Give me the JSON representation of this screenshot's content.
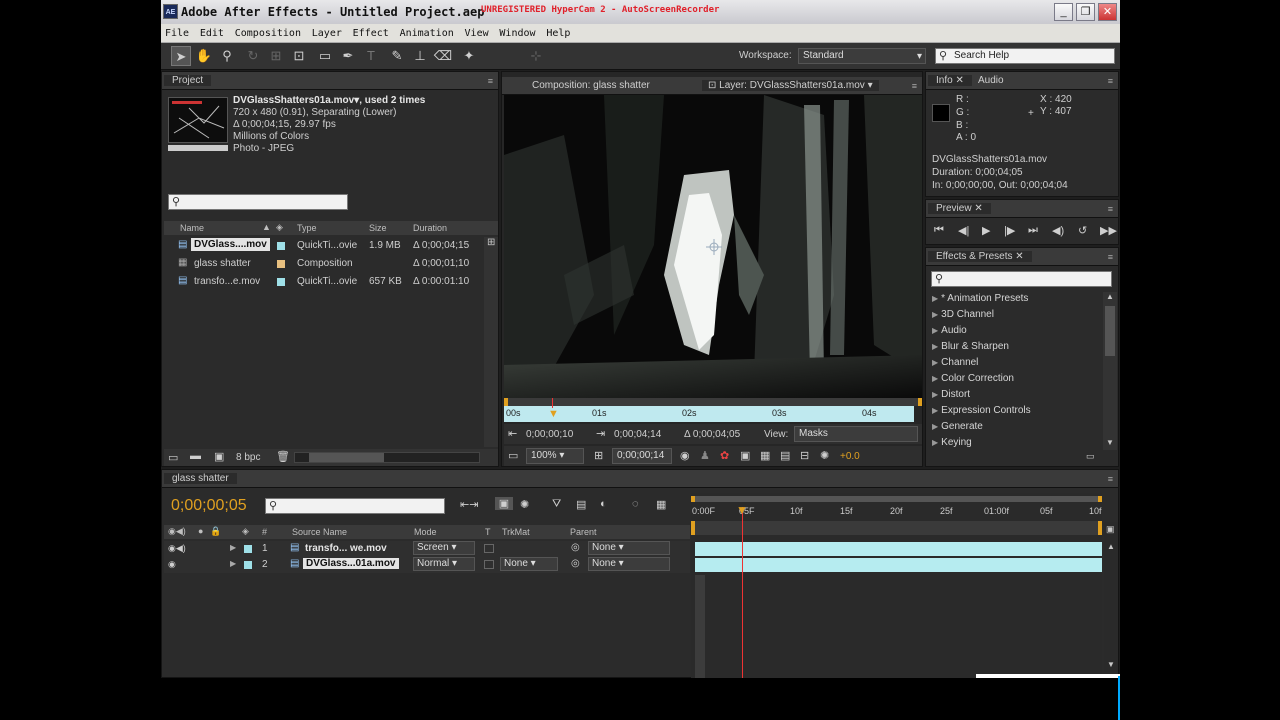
{
  "title_bar": {
    "logo": "AE",
    "title": "Adobe After Effects - Untitled Project.aep",
    "overlay": "UNREGISTERED HyperCam 2 - AutoScreenRecorder"
  },
  "menu": [
    "File",
    "Edit",
    "Composition",
    "Layer",
    "Effect",
    "Animation",
    "View",
    "Window",
    "Help"
  ],
  "toolbar": {
    "workspace_label": "Workspace:",
    "workspace_value": "Standard",
    "search_placeholder": "Search Help"
  },
  "project": {
    "tab": "Project",
    "info_name": "DVGlassShatters01a.mov▾, used 2 times",
    "info_size": "720 x 480 (0.91), Separating (Lower)",
    "info_duration": "Δ 0;00;04;15, 29.97 fps",
    "info_colors": "Millions of Colors",
    "info_codec": "Photo - JPEG",
    "columns": [
      "Name",
      "Type",
      "Size",
      "Duration"
    ],
    "items": [
      {
        "name": "DVGlass....mov",
        "type": "QuickTi...ovie",
        "size": "1.9 MB",
        "duration": "Δ 0;00;04;15",
        "color": "#9fe0e8"
      },
      {
        "name": "glass shatter",
        "type": "Composition",
        "size": "",
        "duration": "Δ 0;00;01;10",
        "color": "#e8c080"
      },
      {
        "name": "transfo...e.mov",
        "type": "QuickTi...ovie",
        "size": "657 KB",
        "duration": "Δ 0:00:01:10",
        "color": "#9fe0e8"
      }
    ],
    "bpc": "8 bpc"
  },
  "viewer": {
    "tab_comp": "Composition: glass shatter",
    "tab_layer": "Layer: DVGlassShatters01a.mov",
    "ruler_ticks": [
      "00s",
      "01s",
      "02s",
      "03s",
      "04s"
    ],
    "in_time": "0;00;00;10",
    "out_time": "0;00;04;14",
    "dur_time": "Δ 0;00;04;05",
    "view_label": "View:",
    "view_value": "Masks",
    "zoom": "100%",
    "current_time": "0;00;00;14",
    "exposure": "+0.0"
  },
  "info": {
    "tab_info": "Info",
    "tab_audio": "Audio",
    "r": "R :",
    "g": "G :",
    "b": "B :",
    "a": "A : 0",
    "x": "X : 420",
    "y": "Y : 407",
    "file": "DVGlassShatters01a.mov",
    "duration": "Duration: 0;00;04;05",
    "in_out": "In: 0;00;00;00, Out: 0;00;04;04"
  },
  "preview": {
    "tab": "Preview"
  },
  "effects": {
    "tab": "Effects & Presets",
    "items": [
      "* Animation Presets",
      "3D Channel",
      "Audio",
      "Blur & Sharpen",
      "Channel",
      "Color Correction",
      "Distort",
      "Expression Controls",
      "Generate",
      "Keying"
    ]
  },
  "timeline": {
    "tab": "glass shatter",
    "current_time": "0;00;00;05",
    "columns": [
      "#",
      "Source Name",
      "Mode",
      "T",
      "TrkMat",
      "Parent"
    ],
    "ruler_ticks": [
      "0:00F",
      "05F",
      "10f",
      "15f",
      "20f",
      "25f",
      "01:00f",
      "05f",
      "10f"
    ],
    "layers": [
      {
        "num": "1",
        "name": "transfo... we.mov",
        "mode": "Screen",
        "trkmat": "",
        "parent": "None"
      },
      {
        "num": "2",
        "name": "DVGlass...01a.mov",
        "mode": "Normal",
        "trkmat": "None",
        "parent": "None"
      }
    ],
    "playhead_fraction": 0.125
  }
}
